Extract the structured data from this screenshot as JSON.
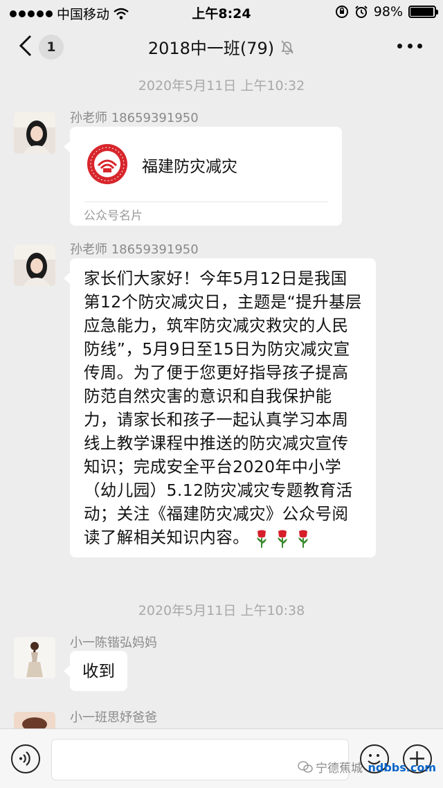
{
  "status_bar": {
    "carrier": "中国移动",
    "time": "上午8:24",
    "battery_percent": "98%",
    "battery_level": 0.98
  },
  "nav": {
    "unread_count": "1",
    "title": "2018中一班(79)",
    "icons": {
      "back": "chevron-left-icon",
      "mute": "bell-off-icon",
      "more": "more-dots-icon"
    }
  },
  "messages": [
    {
      "timestamp": "2020年5月11日 上午10:32"
    },
    {
      "sender": "孙老师 18659391950",
      "type": "card",
      "card_name": "福建防灾减灾",
      "card_type": "公众号名片"
    },
    {
      "sender": "孙老师 18659391950",
      "type": "text",
      "text": "家长们大家好！今年5月12日是我国第12个防灾减灾日，主题是“提升基层应急能力，筑牢防灾减灾救灾的人民防线”，5月9日至15日为防灾减灾宣传周。为了便于您更好指导孩子提高防范自然灾害的意识和自我保护能力，请家长和孩子一起认真学习本周线上教学课程中推送的防灾减灾宣传知识；完成安全平台2020年中小学（幼儿园）5.12防灾减灾专题教育活动；关注《福建防灾减灾》公众号阅读了解相关知识内容。",
      "emoji": "rose-icon x3"
    },
    {
      "timestamp": "2020年5月11日 上午10:38"
    },
    {
      "sender": "小一陈锴弘妈妈",
      "type": "text",
      "text": "收到"
    },
    {
      "sender": "小一班思妤爸爸",
      "type": "partial"
    }
  ],
  "input_bar": {
    "watermark": "宁德蕉城",
    "site": "ndbbs.com",
    "icons": {
      "voice": "voice-icon",
      "emoji": "emoji-icon",
      "plus": "plus-icon"
    }
  },
  "colors": {
    "background": "#ededed",
    "bubble": "#ffffff",
    "timestamp": "#a8a8a8",
    "sender": "#8a8a8a",
    "logo_red": "#d7262c"
  }
}
